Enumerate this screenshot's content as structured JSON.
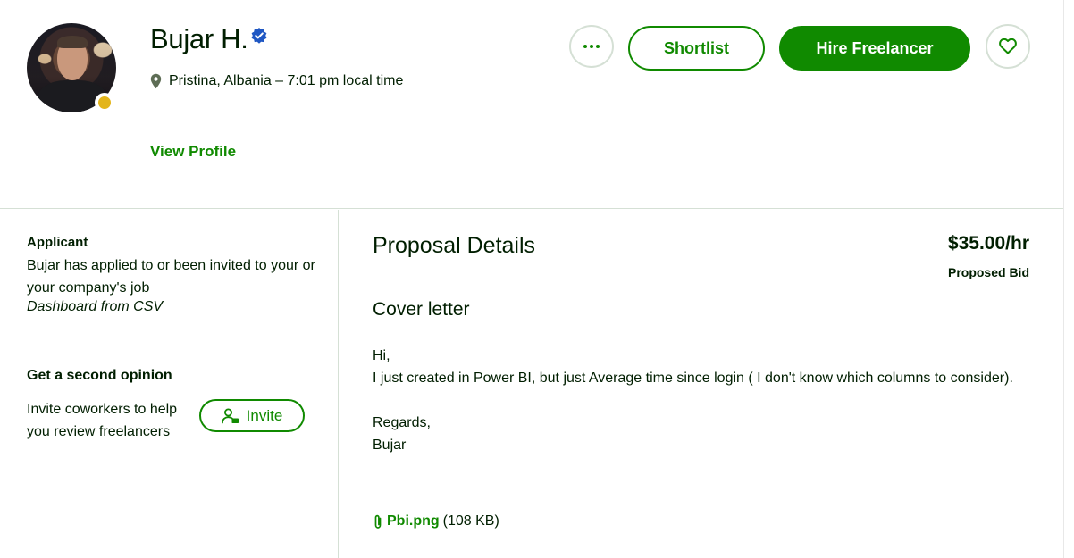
{
  "freelancer": {
    "name": "Bujar H.",
    "location": "Pristina, Albania – 7:01 pm local time",
    "view_profile_label": "View Profile",
    "status_color": "#e3b51b",
    "verified_icon": "verified-badge-icon"
  },
  "actions": {
    "more_icon": "more-dots-icon",
    "shortlist_label": "Shortlist",
    "hire_label": "Hire Freelancer",
    "favorite_icon": "heart-icon"
  },
  "sidebar": {
    "applicant_title": "Applicant",
    "applicant_text": "Bujar has applied to or been invited to your or your company's job",
    "job_title": "Dashboard from CSV",
    "second_opinion_title": "Get a second opinion",
    "second_opinion_text": "Invite coworkers to help you review freelancers",
    "invite_label": "Invite"
  },
  "proposal": {
    "title": "Proposal Details",
    "bid_amount": "$35.00/hr",
    "bid_label": "Proposed Bid",
    "cover_letter_title": "Cover letter",
    "cover_letter_lines": [
      "Hi,",
      "I just created in Power BI, but just Average time since login ( I don't know which columns to consider).",
      "",
      "Regards,",
      "Bujar"
    ],
    "attachment_name": "Pbi.png",
    "attachment_size": "(108 KB)"
  },
  "colors": {
    "brand_green": "#108a00",
    "text_dark": "#001e00",
    "border": "#d5e0d5"
  }
}
